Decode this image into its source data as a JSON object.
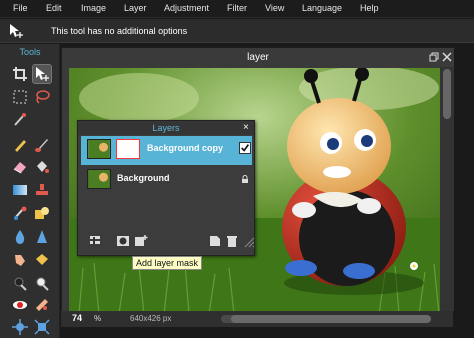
{
  "menu": [
    "File",
    "Edit",
    "Image",
    "Layer",
    "Adjustment",
    "Filter",
    "View",
    "Language",
    "Help"
  ],
  "options_bar": {
    "message": "This tool has no additional options"
  },
  "tools_panel": {
    "title": "Tools"
  },
  "document": {
    "title": "layer",
    "zoom": "74",
    "zoom_unit": "%",
    "dimensions": "640x426 px"
  },
  "layers_panel": {
    "title": "Layers",
    "close": "×",
    "layers": [
      {
        "name": "Background copy",
        "visible": true,
        "active": true
      },
      {
        "name": "Background",
        "locked": true,
        "active": false
      }
    ]
  },
  "tooltip": "Add layer mask",
  "colors": {
    "accent": "#58b4d6",
    "menubar": "#1c1c1c",
    "panel": "#3c3c3c"
  }
}
